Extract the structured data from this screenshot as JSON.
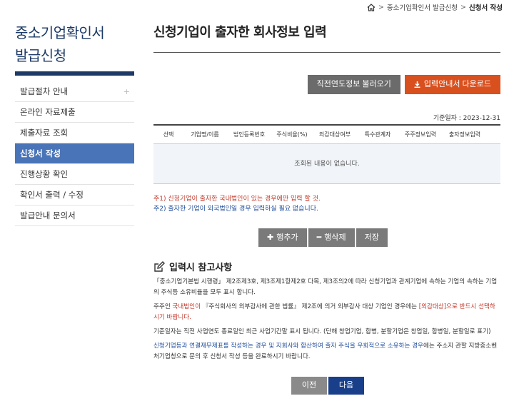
{
  "breadcrumb": {
    "home_icon": "home-icon",
    "item1": "중소기업확인서 발급신청",
    "item2": "신청서 작성"
  },
  "sidebar": {
    "title_line1": "중소기업확인서",
    "title_line2": "발급신청",
    "items": [
      {
        "label": "발급절차 안내",
        "plus": "+"
      },
      {
        "label": "온라인 자료제출"
      },
      {
        "label": "제출자료 조회"
      },
      {
        "label": "신청서 작성"
      },
      {
        "label": "진행상황 확인"
      },
      {
        "label": "확인서 출력 / 수정"
      },
      {
        "label": "발급안내 문의서"
      }
    ],
    "active_index": 3
  },
  "main": {
    "title": "신청기업이 출자한 회사정보 입력",
    "btn_load_prev": "직전연도정보 불러오기",
    "btn_download": "입력안내서 다운로드",
    "base_date": "기준일자 : 2023-12-31",
    "table": {
      "columns": [
        "선택",
        "기업명/이름",
        "법인등록번호",
        "주식비율(%)",
        "외감대상여부",
        "특수관계자",
        "주주정보입력",
        "출자정보입력"
      ],
      "empty_message": "조회된 내용이 없습니다."
    },
    "note1": "주1) 신청기업이 출자한 국내법인이 있는 경우에만 입력 할 것.",
    "note2": "주2) 출자한 기업이 외국법인일 경우 입력하실 필요 없습니다.",
    "btn_add_row": "행추가",
    "btn_del_row": "행삭제",
    "btn_save": "저장",
    "ref_title": "입력시 참고사항",
    "ref_p1": "「중소기업기본법 시행령」 제2조제3호, 제3조제1항제2호 다목, 제3조의2에 따라 신청기업과 관계기업에 속하는 기업의 속하는 기업의 주식등 소유비율을 모두 표시 합니다.",
    "ref_p2_a": "주주인 ",
    "ref_p2_b": "국내법인이",
    "ref_p2_c": " 『주식회사의 외부감사에 관한 법률』 제2조에 의거 외부감사 대상 기업인 경우에는 ",
    "ref_p2_d": "[외감대상]으로 반드시 선택하시기 바랍니다.",
    "ref_p3": "기준일자는 직전 사업연도 종료일인 최근 사업기간말 표시 됩니다. (단해 창업기업, 합병, 분할기업은 창업일, 합병일, 분할일로 표기)",
    "ref_p4_a": "신청기업등과 연결재무제표를 작성하는 경우 및 지회사와 합산하여 출자 주식을 우회적으로 소유하는 경우",
    "ref_p4_b": "에는 주소지 관할 지방중소벤처기업청으로 문의 후 신청서 작성 등을 완료하시기 바랍니다.",
    "btn_prev": "이전",
    "btn_next": "다음"
  },
  "colors": {
    "brand_navy": "#1d3a66",
    "active_menu": "#4a74b8",
    "download_orange": "#d9501f",
    "next_blue": "#1a3f8a",
    "note_red": "#c0392b",
    "note_blue": "#1f4b99"
  }
}
